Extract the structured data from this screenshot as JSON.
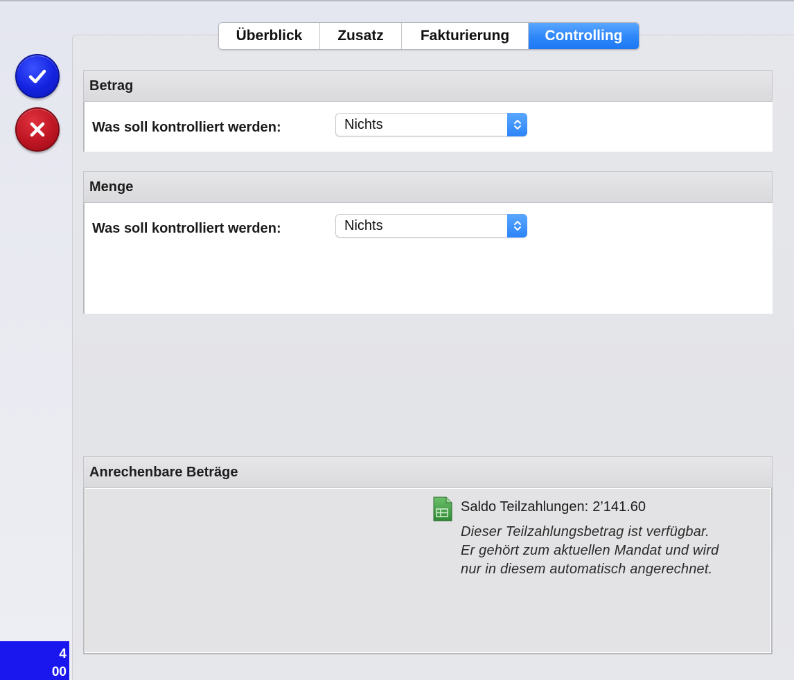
{
  "tabs": [
    {
      "label": "Überblick",
      "active": false
    },
    {
      "label": "Zusatz",
      "active": false
    },
    {
      "label": "Fakturierung",
      "active": false
    },
    {
      "label": "Controlling",
      "active": true
    }
  ],
  "actions": {
    "confirm_icon": "checkmark-icon",
    "cancel_icon": "close-icon",
    "confirm_color": "#1422e0",
    "cancel_color": "#be1522"
  },
  "betrag": {
    "header": "Betrag",
    "label": "Was soll kontrolliert werden:",
    "selected": "Nichts"
  },
  "menge": {
    "header": "Menge",
    "label": "Was soll kontrolliert werden:",
    "selected": "Nichts"
  },
  "anrechenbar": {
    "header": "Anrechenbare Beträge",
    "saldo_label": "Saldo Teilzahlungen:",
    "saldo_value": "2’141.60",
    "note_lines": [
      "Dieser Teilzahlungsbetrag ist verfügbar.",
      "Er gehört zum aktuellen Mandat und wird",
      "nur in diesem automatisch angerechnet."
    ]
  },
  "counter": {
    "line1": "4",
    "line2": "00"
  },
  "colors": {
    "accent": "#2d86fa",
    "counter_bg": "#1a17ee"
  }
}
